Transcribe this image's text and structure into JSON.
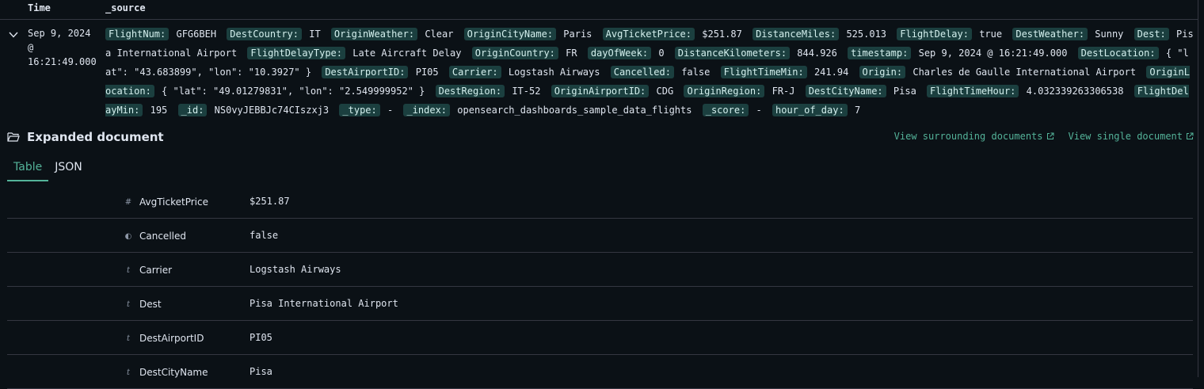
{
  "header": {
    "time_col": "Time",
    "source_col": "_source"
  },
  "row": {
    "time_lines": [
      "Sep 9, 2024",
      "@",
      "16:21:49.000"
    ],
    "source_fields": [
      {
        "k": "FlightNum:",
        "v": "GFG6BEH"
      },
      {
        "k": "DestCountry:",
        "v": "IT"
      },
      {
        "k": "OriginWeather:",
        "v": "Clear"
      },
      {
        "k": "OriginCityName:",
        "v": "Paris"
      },
      {
        "k": "AvgTicketPrice:",
        "v": "$251.87"
      },
      {
        "k": "DistanceMiles:",
        "v": "525.013"
      },
      {
        "k": "FlightDelay:",
        "v": "true"
      },
      {
        "k": "DestWeather:",
        "v": "Sunny"
      },
      {
        "k": "Dest:",
        "v": "Pisa International Airport"
      },
      {
        "k": "FlightDelayType:",
        "v": "Late Aircraft Delay"
      },
      {
        "k": "OriginCountry:",
        "v": "FR"
      },
      {
        "k": "dayOfWeek:",
        "v": "0"
      },
      {
        "k": "DistanceKilometers:",
        "v": "844.926"
      },
      {
        "k": "timestamp:",
        "v": "Sep 9, 2024 @ 16:21:49.000"
      },
      {
        "k": "DestLocation:",
        "v": "{ \"lat\": \"43.683899\", \"lon\": \"10.3927\" }"
      },
      {
        "k": "DestAirportID:",
        "v": "PI05"
      },
      {
        "k": "Carrier:",
        "v": "Logstash Airways"
      },
      {
        "k": "Cancelled:",
        "v": "false"
      },
      {
        "k": "FlightTimeMin:",
        "v": "241.94"
      },
      {
        "k": "Origin:",
        "v": "Charles de Gaulle International Airport"
      },
      {
        "k": "OriginLocation:",
        "v": "{ \"lat\": \"49.01279831\", \"lon\": \"2.549999952\" }"
      },
      {
        "k": "DestRegion:",
        "v": "IT-52"
      },
      {
        "k": "OriginAirportID:",
        "v": "CDG"
      },
      {
        "k": "OriginRegion:",
        "v": "FR-J"
      },
      {
        "k": "DestCityName:",
        "v": "Pisa"
      },
      {
        "k": "FlightTimeHour:",
        "v": "4.032339263306538"
      },
      {
        "k": "FlightDelayMin:",
        "v": "195"
      },
      {
        "k": "_id:",
        "v": "NS0vyJEBBJc74CIszxj3"
      },
      {
        "k": "_type:",
        "v": "-"
      },
      {
        "k": "_index:",
        "v": "opensearch_dashboards_sample_data_flights"
      },
      {
        "k": "_score:",
        "v": "-"
      },
      {
        "k": "hour_of_day:",
        "v": "7"
      }
    ]
  },
  "expanded": {
    "title": "Expanded document",
    "link_surrounding": "View surrounding documents",
    "link_single": "View single document",
    "tabs": [
      "Table",
      "JSON"
    ],
    "accent": "#54b399",
    "fields": [
      {
        "icon": "#",
        "icon_name": "number-type-icon",
        "name": "AvgTicketPrice",
        "value": "$251.87"
      },
      {
        "icon": "◐",
        "icon_name": "boolean-type-icon",
        "name": "Cancelled",
        "value": "false"
      },
      {
        "icon": "t",
        "icon_name": "string-type-icon",
        "name": "Carrier",
        "value": "Logstash Airways"
      },
      {
        "icon": "t",
        "icon_name": "string-type-icon",
        "name": "Dest",
        "value": "Pisa International Airport"
      },
      {
        "icon": "t",
        "icon_name": "string-type-icon",
        "name": "DestAirportID",
        "value": "PI05"
      },
      {
        "icon": "t",
        "icon_name": "string-type-icon",
        "name": "DestCityName",
        "value": "Pisa"
      }
    ]
  }
}
